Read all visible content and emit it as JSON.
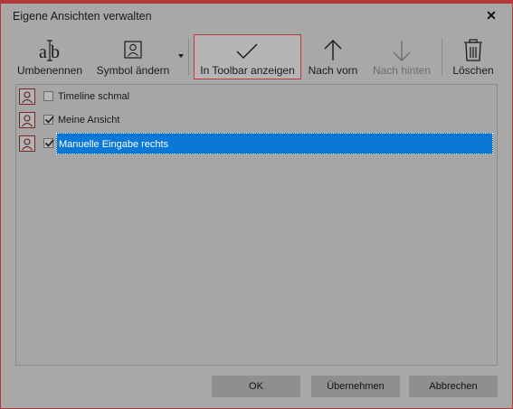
{
  "window": {
    "title": "Eigene Ansichten verwalten"
  },
  "toolbar": {
    "rename": "Umbenennen",
    "change_symbol": "Symbol ändern",
    "show_in_toolbar": "In Toolbar anzeigen",
    "move_up": "Nach vorn",
    "move_down": "Nach hinten",
    "delete": "Löschen"
  },
  "views": [
    {
      "label": "Timeline schmal",
      "checked": false,
      "selected": false
    },
    {
      "label": "Meine Ansicht",
      "checked": true,
      "selected": false
    },
    {
      "label": "Manuelle Eingabe rechts",
      "checked": true,
      "selected": true
    }
  ],
  "footer": {
    "ok": "OK",
    "apply": "Übernehmen",
    "cancel": "Abbrechen"
  },
  "colors": {
    "accent": "#c23b3b",
    "selection": "#0a78d6",
    "background": "#a8a8a8"
  }
}
